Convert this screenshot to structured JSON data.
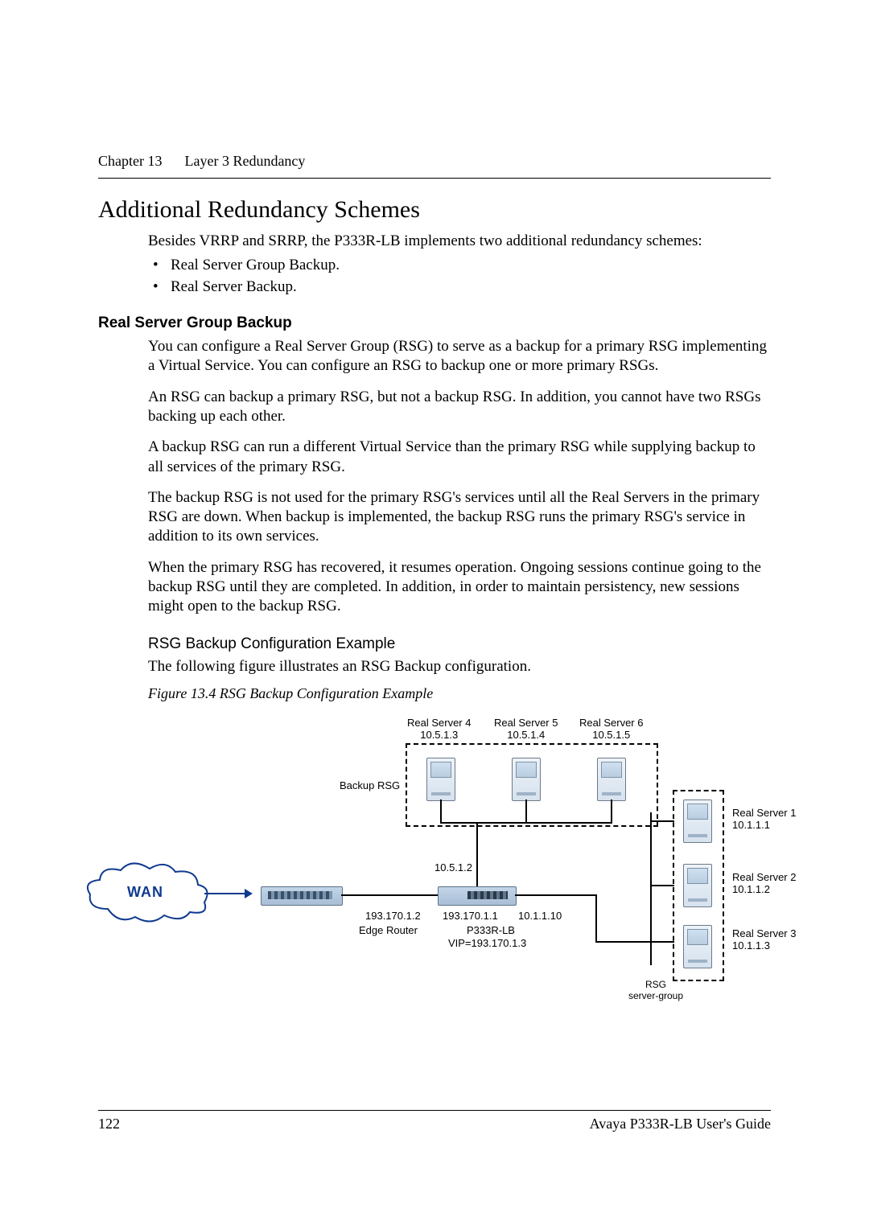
{
  "header": {
    "chapter": "Chapter 13",
    "title": "Layer 3 Redundancy"
  },
  "section": {
    "h1": "Additional Redundancy Schemes",
    "intro": "Besides VRRP and SRRP, the P333R-LB implements two additional redundancy schemes:",
    "bullets": [
      "Real Server Group Backup.",
      "Real Server Backup."
    ],
    "h2": "Real Server Group Backup",
    "p1": "You can configure a Real Server Group (RSG) to serve as a backup for a primary RSG implementing a Virtual Service. You can configure an RSG to backup one or more primary RSGs.",
    "p2": "An RSG can backup a primary RSG, but not a backup RSG. In addition, you cannot have two RSGs backing up each other.",
    "p3": "A backup RSG can run a different Virtual Service than the primary RSG while supplying backup to all services of the primary RSG.",
    "p4": "The backup RSG is not used for the primary RSG's services until all the Real Servers in the primary RSG are down. When backup is implemented, the backup RSG runs the primary RSG's service in addition to its own services.",
    "p5": "When the primary RSG has recovered, it resumes operation. Ongoing sessions continue going to the backup RSG until they are completed. In addition, in order to maintain persistency, new sessions might open to the backup RSG.",
    "h3": "RSG Backup Configuration Example",
    "p6": "The following figure illustrates an RSG Backup configuration.",
    "figcaption": "Figure 13.4    RSG Backup Configuration Example"
  },
  "diagram": {
    "backup_servers": [
      {
        "name": "Real Server 4",
        "ip": "10.5.1.3"
      },
      {
        "name": "Real Server 5",
        "ip": "10.5.1.4"
      },
      {
        "name": "Real Server 6",
        "ip": "10.5.1.5"
      }
    ],
    "backup_group_label": "Backup RSG",
    "primary_servers": [
      {
        "name": "Real Server 1",
        "ip": "10.1.1.1"
      },
      {
        "name": "Real Server 2",
        "ip": "10.1.1.2"
      },
      {
        "name": "Real Server 3",
        "ip": "10.1.1.3"
      }
    ],
    "primary_group_label_1": "RSG",
    "primary_group_label_2": "server-group",
    "wan_label": "WAN",
    "edge_router": {
      "label": "Edge Router",
      "ip": "193.170.1.2"
    },
    "lb": {
      "label": "P333R-LB",
      "ip_left": "193.170.1.1",
      "ip_right": "10.1.1.10",
      "vip": "VIP=193.170.1.3"
    },
    "link_up_ip": "10.5.1.2"
  },
  "footer": {
    "page": "122",
    "guide": "Avaya P333R-LB User's Guide"
  }
}
